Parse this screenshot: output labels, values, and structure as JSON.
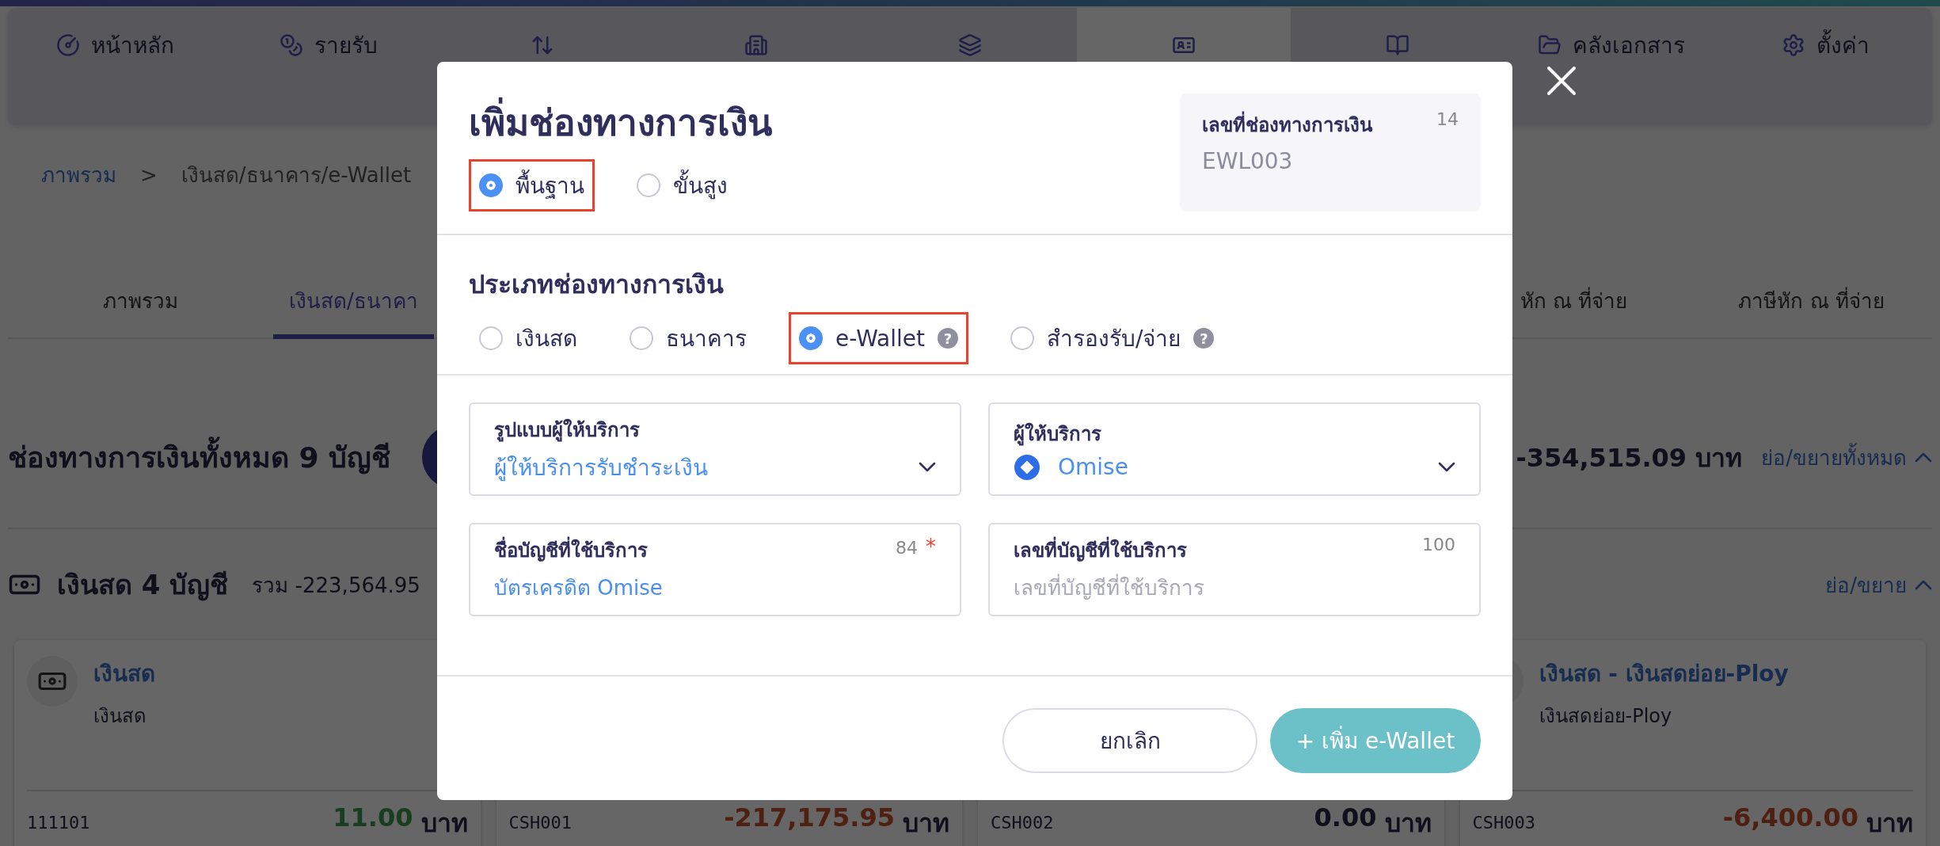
{
  "nav": {
    "items": [
      {
        "label": "หน้าหลัก",
        "selected": false
      },
      {
        "label": "รายรับ",
        "selected": false
      },
      {
        "selected": false
      },
      {
        "selected": false
      },
      {
        "selected": false
      },
      {
        "selected": true
      },
      {
        "selected": false
      },
      {
        "label": "คลังเอกสาร",
        "selected": false
      },
      {
        "label": "ตั้งค่า",
        "selected": false
      }
    ]
  },
  "breadcrumb": {
    "root": "ภาพรวม",
    "separator": ">",
    "current": "เงินสด/ธนาคาร/e-Wallet"
  },
  "tabs": [
    {
      "label": "ภาพรวม",
      "selected": false
    },
    {
      "label": "เงินสด/ธนาคา",
      "selected": true
    },
    {
      "label": "หัก ณ ที่จ่าย",
      "selected": false
    },
    {
      "label": "ภาษีหัก ณ ที่จ่าย",
      "selected": false
    }
  ],
  "summary": {
    "title": "ช่องทางการเงินทั้งหมด 9 บัญชี",
    "total": "-354,515.09 บาท",
    "toggle": "ย่อ/ขยายทั้งหมด"
  },
  "section": {
    "title": "เงินสด 4 บัญชี",
    "total": "รวม -223,564.95",
    "toggle": "ย่อ/ขยาย"
  },
  "cards": [
    {
      "title": "เงินสด",
      "subtitle": "เงินสด",
      "code": "111101",
      "amount": "11.00",
      "unit": "บาท",
      "kind": "positive"
    },
    {
      "code": "CSH001",
      "amount": "-217,175.95",
      "unit": "บาท",
      "kind": "negative"
    },
    {
      "code": "CSH002",
      "amount": "0.00",
      "unit": "บาท",
      "kind": "zero"
    },
    {
      "title": "เงินสด - เงินสดย่อย-Ploy",
      "subtitle": "เงินสดย่อย-Ploy",
      "code": "CSH003",
      "amount": "-6,400.00",
      "unit": "บาท",
      "kind": "negative"
    }
  ],
  "dialog": {
    "title": "เพิ่มช่องทางการเงิน",
    "modes": [
      {
        "label": "พื้นฐาน",
        "selected": true,
        "highlighted": true
      },
      {
        "label": "ขั้นสูง",
        "selected": false,
        "highlighted": false
      }
    ],
    "number_field": {
      "label": "เลขที่ช่องทางการเงิน",
      "counter": "14",
      "value": "EWL003",
      "disabled": true
    },
    "type_section": {
      "title": "ประเภทช่องทางการเงิน",
      "options": [
        {
          "label": "เงินสด",
          "selected": false,
          "highlighted": false
        },
        {
          "label": "ธนาคาร",
          "selected": false,
          "highlighted": false
        },
        {
          "label": "e-Wallet",
          "selected": true,
          "highlighted": true,
          "help": "?"
        },
        {
          "label": "สำรองรับ/จ่าย",
          "selected": false,
          "highlighted": false,
          "help": "?"
        }
      ]
    },
    "fields": [
      {
        "kind": "select",
        "label": "รูปแบบผู้ให้บริการ",
        "value": "ผู้ให้บริการรับชำระเงิน",
        "logo": false
      },
      {
        "kind": "select",
        "label": "ผู้ให้บริการ",
        "value": "Omise",
        "logo": true
      },
      {
        "kind": "input",
        "label": "ชื่อบัญชีที่ใช้บริการ",
        "counter": "84",
        "required_mark": "*",
        "value": "บัตรเครดิต Omise"
      },
      {
        "kind": "input",
        "label": "เลขที่บัญชีที่ใช้บริการ",
        "counter": "100",
        "placeholder": "เลขที่บัญชีที่ใช้บริการ"
      }
    ],
    "buttons": {
      "cancel": "ยกเลิก",
      "submit": "+ เพิ่ม e-Wallet"
    }
  }
}
